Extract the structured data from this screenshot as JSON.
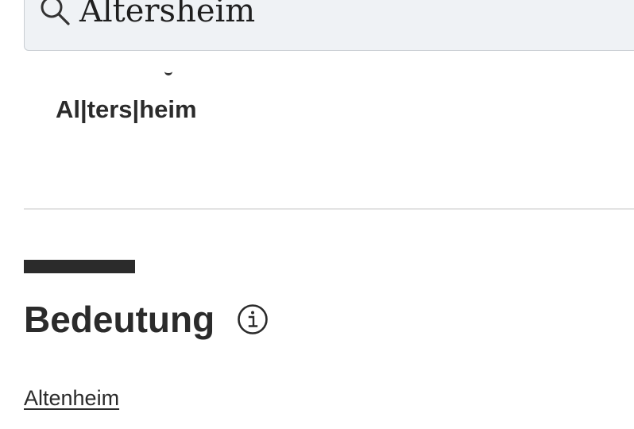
{
  "search": {
    "value": "Altersheim"
  },
  "entry": {
    "syllables": "Al|ters|heim"
  },
  "meaning_section": {
    "title": "Bedeutung",
    "info_icon": "info-circle-icon",
    "link_text": "Altenheim"
  },
  "colors": {
    "search_background": "#eff2f5",
    "search_border": "#c9ced3",
    "text": "#2b2b2b",
    "divider": "#e3e3e3"
  }
}
